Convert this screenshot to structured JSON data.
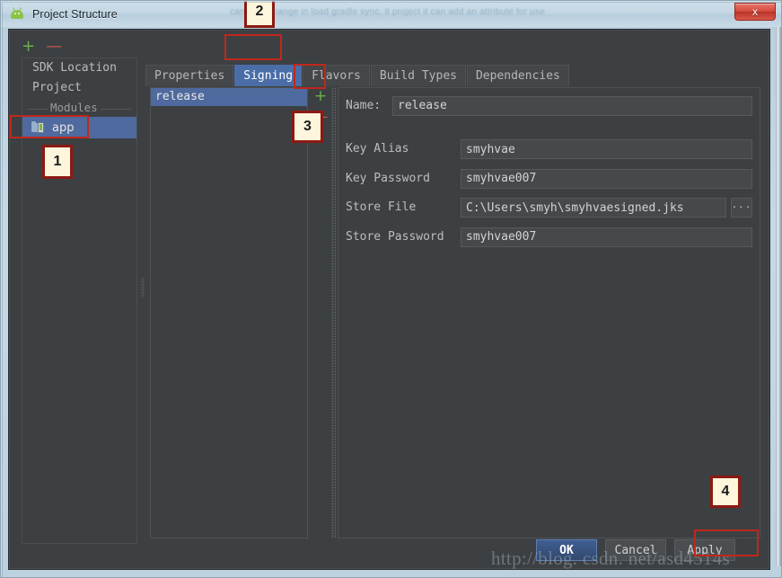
{
  "window": {
    "title": "Project Structure",
    "app_icon": "android-studio-icon",
    "close_label": "x",
    "ghost_text": "can help change in load gradle sync, it project it can add an attribute for use"
  },
  "sidebar": {
    "add_label": "+",
    "remove_label": "—",
    "items": [
      {
        "label": "SDK Location",
        "selected": false
      },
      {
        "label": "Project",
        "selected": false
      }
    ],
    "modules_header": "Modules",
    "module": {
      "label": "app",
      "icon": "module-folder-icon",
      "selected": true
    }
  },
  "tabs": [
    {
      "label": "Properties",
      "selected": false
    },
    {
      "label": "Signing",
      "selected": true
    },
    {
      "label": "Flavors",
      "selected": false
    },
    {
      "label": "Build Types",
      "selected": false
    },
    {
      "label": "Dependencies",
      "selected": false
    }
  ],
  "config_list": {
    "items": [
      {
        "label": "release",
        "selected": true
      }
    ],
    "add_label": "+",
    "remove_label": "—"
  },
  "form": {
    "name": {
      "label": "Name:",
      "value": "release"
    },
    "fields": [
      {
        "label": "Key Alias",
        "value": "smyhvae"
      },
      {
        "label": "Key Password",
        "value": "smyhvae007"
      },
      {
        "label": "Store File",
        "value": "C:\\Users\\smyh\\smyhvaesigned.jks",
        "browse": "···"
      },
      {
        "label": "Store Password",
        "value": "smyhvae007"
      }
    ]
  },
  "buttons": {
    "ok": "OK",
    "cancel": "Cancel",
    "apply": "Apply"
  },
  "watermark": "http://blog. csdn. net/asd4514s",
  "annotations": {
    "badge1": "1",
    "badge2": "2",
    "badge3": "3",
    "badge4": "4"
  }
}
